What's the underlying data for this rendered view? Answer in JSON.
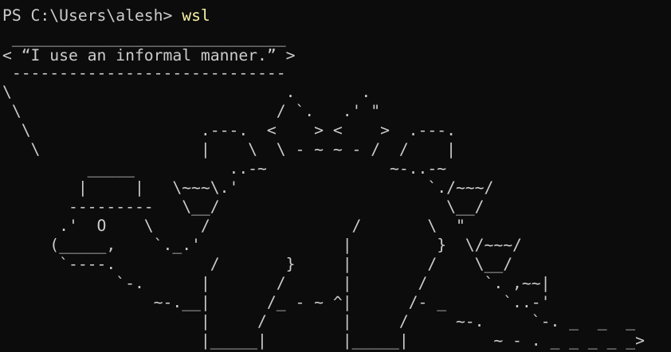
{
  "terminal": {
    "prompt": "PS C:\\Users\\alesh> ",
    "command": "wsl",
    "colors": {
      "background": "#0c0c0c",
      "foreground": "#cccccc",
      "command": "#f9f1a5"
    },
    "output_lines": [
      " _____________________________",
      "< “I use an informal manner.” >",
      " -----------------------------",
      "\\                             .       .",
      " \\                           / `.   .' \"",
      "  \\                  .---.  <    > <    >  .---.",
      "   \\                 |    \\  \\ - ~ ~ - /  /    |",
      "         _____          ..-~             ~-..-~",
      "        |     |   \\~~~\\.'                    `./~~~/",
      "       ---------   \\__/                        \\__/",
      "      .'  O    \\     /               /       \\  \"",
      "     (_____,    `._.'               |         }  \\/~~~/",
      "      `----.          /       }     |        /    \\__/",
      "            `-.      |       /      |       /      `. ,~~|",
      "                ~-.__|      /_ - ~ ^|      /- _      `..-'",
      "                     |     /        |     /     ~-.     `-. _  _  _",
      "                     |_____|        |_____|         ~ - . _ _ _ _ _>"
    ]
  }
}
